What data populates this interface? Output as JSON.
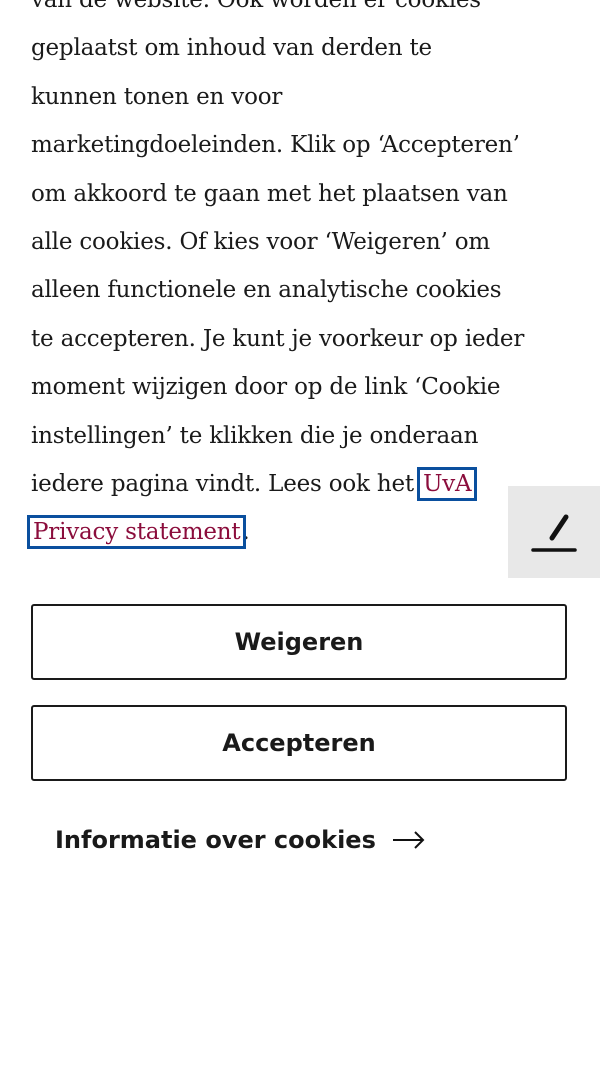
{
  "cookie_banner": {
    "text_lines": [
      "van de website. Ook worden er cookies",
      "geplaatst om inhoud van derden te",
      "kunnen tonen en voor",
      "marketingdoeleinden. Klik op ‘Accepteren’",
      "om akkoord te gaan met het plaatsen van",
      "alle cookies. Of kies voor ‘Weigeren’ om",
      "alleen functionele en analytische cookies",
      "te accepteren. Je kunt je voorkeur op ieder",
      "moment wijzigen door op de link ‘Cookie",
      "instellingen’ te klikken die je onderaan"
    ],
    "line_11_prefix": "iedere pagina vindt. Lees ook het ",
    "privacy_link_part1": "UvA",
    "privacy_link_part2": "Privacy statement",
    "line_12_suffix": ".",
    "refuse_label": "Weigeren",
    "accept_label": "Accepteren",
    "info_link_label": "Informatie over cookies"
  },
  "icons": {
    "edit": "pencil-icon",
    "info_arrow": "arrow-right-icon"
  },
  "colors": {
    "link": "#8b0d3c",
    "focus_outline": "#0a4f9e",
    "text": "#1a1a1a",
    "edit_tab_bg": "#e8e8e8"
  }
}
